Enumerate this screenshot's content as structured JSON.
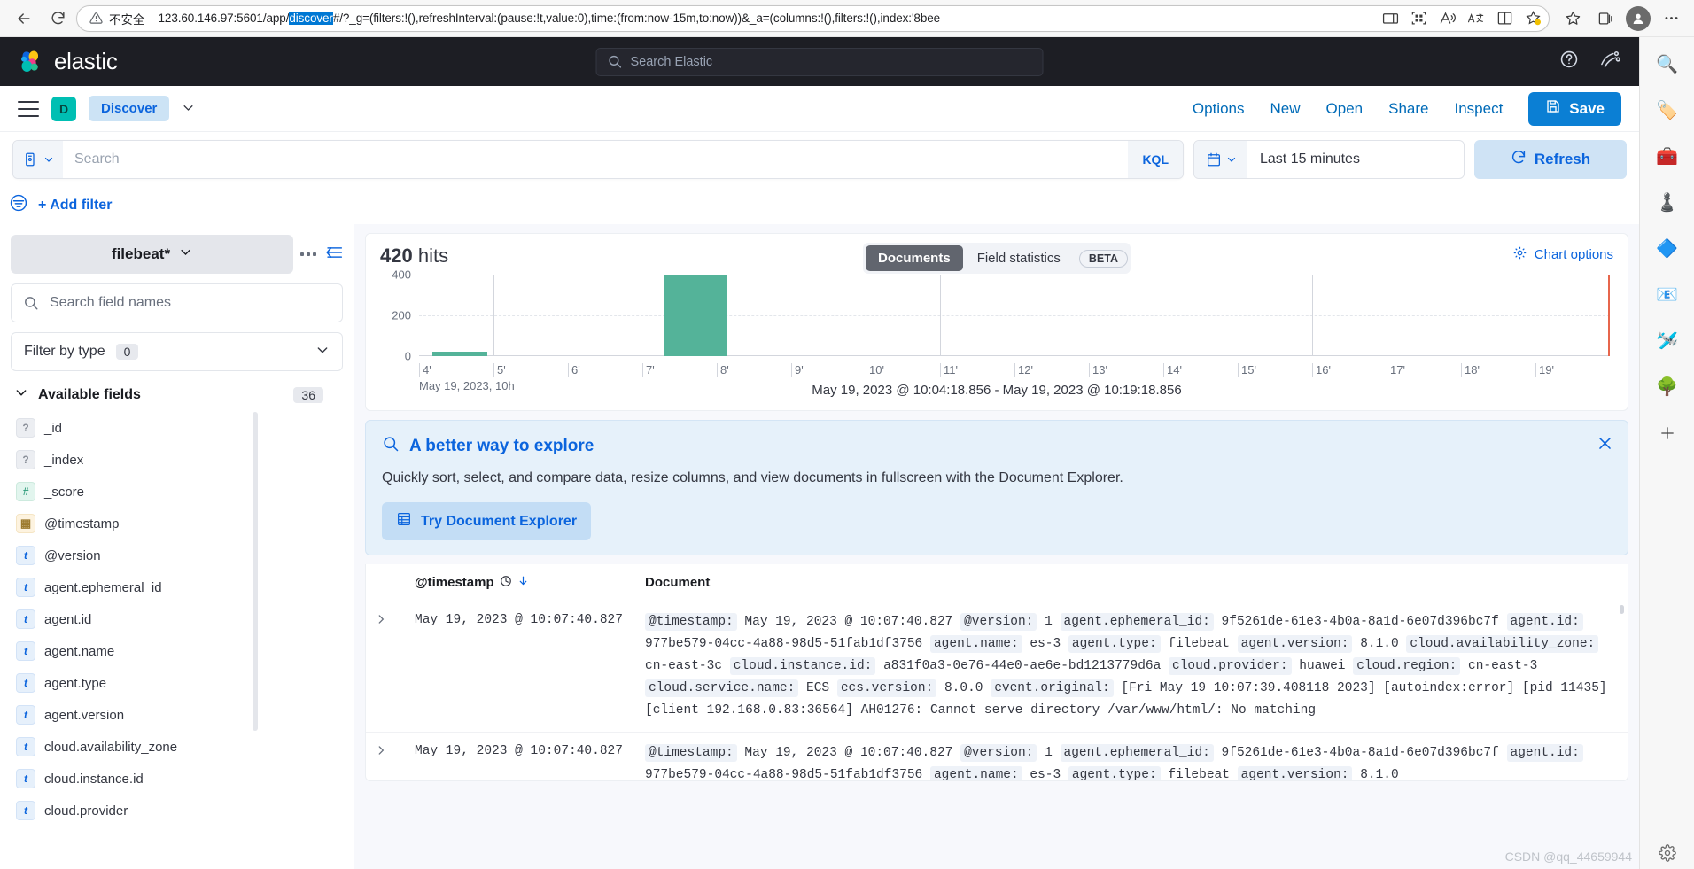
{
  "browser": {
    "back_icon": "back-arrow-icon",
    "reload_icon": "reload-icon",
    "security_label": "不安全",
    "url_before": "123.60.146.97:5601/app/",
    "url_selected": "discover",
    "url_after": "#/?_g=(filters:!(),refreshInterval:(pause:!t,value:0),time:(from:now-15m,to:now))&_a=(columns:!(),filters:!(),index:'8bee",
    "omni_icons": [
      "split-screen-icon",
      "apps-grid-icon",
      "read-aloud-icon",
      "translate-icon",
      "reading-mode-icon",
      "favorite-star-icon"
    ],
    "toolbar_icons": [
      "favorites-icon",
      "collections-icon",
      "profile-avatar-icon",
      "more-options-icon"
    ]
  },
  "taskbar": {
    "icons": [
      "search-icon",
      "tag-icon",
      "toolbox-icon",
      "chess-icon",
      "copilot-icon",
      "outlook-icon",
      "paper-plane-icon",
      "tree-icon",
      "add-icon"
    ],
    "settings_icon": "settings-gear-icon"
  },
  "header": {
    "brand": "elastic",
    "search_placeholder": "Search Elastic",
    "right_icons": [
      "help-icon",
      "deployment-icon"
    ]
  },
  "nav": {
    "menu_icon": "hamburger-menu-icon",
    "app_badge": "D",
    "app_name": "Discover",
    "chevron_icon": "chevron-down-icon",
    "links": [
      "Options",
      "New",
      "Open",
      "Share",
      "Inspect"
    ],
    "save_label": "Save",
    "save_icon": "save-disk-icon"
  },
  "query": {
    "prefix_icon": "saved-query-icon",
    "placeholder": "Search",
    "language": "KQL",
    "date_icon": "calendar-icon",
    "date_value": "Last 15 minutes",
    "refresh_label": "Refresh",
    "refresh_icon": "refresh-icon"
  },
  "filters": {
    "filter_icon": "filter-list-icon",
    "add_filter_label": "+ Add filter"
  },
  "sidebar": {
    "index_pattern": "filebeat*",
    "index_chevron": "chevron-down-icon",
    "more_icon": "more-dots-icon",
    "collapse_icon": "collapse-panel-icon",
    "field_search_placeholder": "Search field names",
    "filter_by_type_label": "Filter by type",
    "filter_by_type_count": "0",
    "available_fields_label": "Available fields",
    "available_fields_count": "36",
    "fields": [
      {
        "name": "_id",
        "type": "unknown",
        "glyph": "?"
      },
      {
        "name": "_index",
        "type": "unknown",
        "glyph": "?"
      },
      {
        "name": "_score",
        "type": "num",
        "glyph": "#"
      },
      {
        "name": "@timestamp",
        "type": "date",
        "glyph": "▦"
      },
      {
        "name": "@version",
        "type": "t",
        "glyph": "t"
      },
      {
        "name": "agent.ephemeral_id",
        "type": "t",
        "glyph": "t"
      },
      {
        "name": "agent.id",
        "type": "t",
        "glyph": "t"
      },
      {
        "name": "agent.name",
        "type": "t",
        "glyph": "t"
      },
      {
        "name": "agent.type",
        "type": "t",
        "glyph": "t"
      },
      {
        "name": "agent.version",
        "type": "t",
        "glyph": "t"
      },
      {
        "name": "cloud.availability_zone",
        "type": "t",
        "glyph": "t"
      },
      {
        "name": "cloud.instance.id",
        "type": "t",
        "glyph": "t"
      },
      {
        "name": "cloud.provider",
        "type": "t",
        "glyph": "t"
      }
    ]
  },
  "chart_panel": {
    "hits_count": "420",
    "hits_label": "hits",
    "tabs": [
      {
        "label": "Documents",
        "active": true
      },
      {
        "label": "Field statistics",
        "active": false
      }
    ],
    "beta_badge": "BETA",
    "chart_options_label": "Chart options",
    "chart_options_icon": "gear-icon",
    "range_label": "May 19, 2023 @ 10:04:18.856 - May 19, 2023 @ 10:19:18.856"
  },
  "chart_data": {
    "type": "bar",
    "title": "",
    "xlabel": "May 19, 2023, 10h",
    "ylabel": "",
    "ylim": [
      0,
      400
    ],
    "yticks": [
      0,
      200,
      400
    ],
    "grid": true,
    "categories": [
      "4'",
      "5'",
      "6'",
      "7'",
      "8'",
      "9'",
      "10'",
      "11'",
      "12'",
      "13'",
      "14'",
      "15'",
      "16'",
      "17'",
      "18'",
      "19'"
    ],
    "values": [
      20,
      0,
      0,
      400,
      0,
      0,
      0,
      0,
      0,
      0,
      0,
      0,
      0,
      0,
      0,
      0
    ],
    "bar_color": "#54b399",
    "end_marker_color": "#e7664c",
    "end_marker_label": "19'"
  },
  "callout": {
    "title": "A better way to explore",
    "title_icon": "magnifier-icon",
    "body": "Quickly sort, select, and compare data, resize columns, and view documents in fullscreen with the Document Explorer.",
    "button_label": "Try Document Explorer",
    "button_icon": "table-icon",
    "close_icon": "close-icon"
  },
  "doc_table": {
    "columns": [
      "@timestamp",
      "Document"
    ],
    "sort_icon": "sort-desc-icon",
    "time_icon": "clock-icon",
    "expand_icon": "expand-row-icon",
    "rows": [
      {
        "timestamp": "May 19, 2023 @ 10:07:40.827",
        "pairs": [
          {
            "k": "@timestamp:",
            "v": "May 19, 2023 @ 10:07:40.827"
          },
          {
            "k": "@version:",
            "v": "1"
          },
          {
            "k": "agent.ephemeral_id:",
            "v": "9f5261de-61e3-4b0a-8a1d-6e07d396bc7f"
          },
          {
            "k": "agent.id:",
            "v": "977be579-04cc-4a88-98d5-51fab1df3756"
          },
          {
            "k": "agent.name:",
            "v": "es-3"
          },
          {
            "k": "agent.type:",
            "v": "filebeat"
          },
          {
            "k": "agent.version:",
            "v": "8.1.0"
          },
          {
            "k": "cloud.availability_zone:",
            "v": "cn-east-3c"
          },
          {
            "k": "cloud.instance.id:",
            "v": "a831f0a3-0e76-44e0-ae6e-bd1213779d6a"
          },
          {
            "k": "cloud.provider:",
            "v": "huawei"
          },
          {
            "k": "cloud.region:",
            "v": "cn-east-3"
          },
          {
            "k": "cloud.service.name:",
            "v": "ECS"
          },
          {
            "k": "ecs.version:",
            "v": "8.0.0"
          },
          {
            "k": "event.original:",
            "v": "[Fri May 19 10:07:39.408118 2023] [autoindex:error] [pid 11435] [client 192.168.0.83:36564] AH01276: Cannot serve directory /var/www/html/: No matching"
          }
        ]
      },
      {
        "timestamp": "May 19, 2023 @ 10:07:40.827",
        "pairs": [
          {
            "k": "@timestamp:",
            "v": "May 19, 2023 @ 10:07:40.827"
          },
          {
            "k": "@version:",
            "v": "1"
          },
          {
            "k": "agent.ephemeral_id:",
            "v": "9f5261de-61e3-4b0a-8a1d-6e07d396bc7f"
          },
          {
            "k": "agent.id:",
            "v": "977be579-04cc-4a88-98d5-51fab1df3756"
          },
          {
            "k": "agent.name:",
            "v": "es-3"
          },
          {
            "k": "agent.type:",
            "v": "filebeat"
          },
          {
            "k": "agent.version:",
            "v": "8.1.0"
          }
        ]
      }
    ]
  },
  "watermark": "CSDN @qq_44659944"
}
